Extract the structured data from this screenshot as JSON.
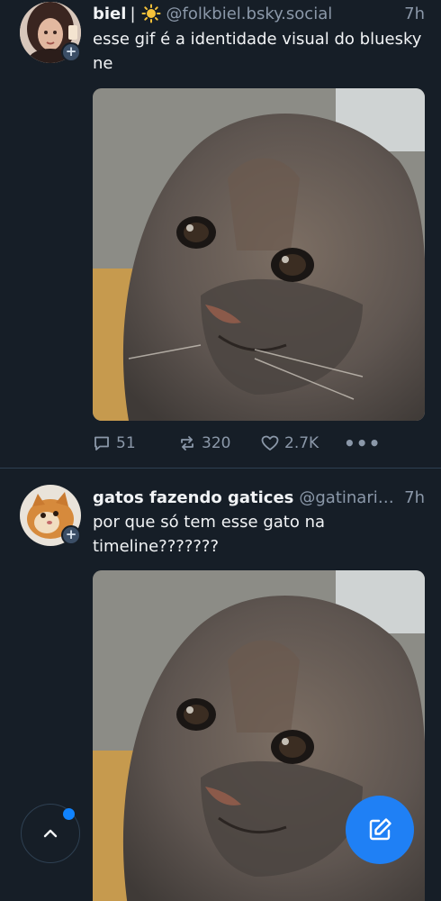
{
  "posts": [
    {
      "display_name": "biel",
      "separator": "|",
      "emoji_icon": "sun-icon",
      "handle": "@folkbiel.bsky.social",
      "time": "7h",
      "text": "esse gif é a identidade visual do bluesky ne",
      "reply_count": "51",
      "repost_count": "320",
      "like_count": "2.7K"
    },
    {
      "display_name": "gatos fazendo gatices",
      "handle": "@gatinarios.b...",
      "time": "7h",
      "text": "por que só tem esse gato na timeline???????"
    }
  ],
  "icons": {
    "reply": "reply-icon",
    "repost": "repost-icon",
    "like": "heart-icon",
    "more": "more-icon",
    "scroll_top": "chevron-up-icon",
    "compose": "compose-icon"
  },
  "more_glyph": "•••",
  "follow_glyph": "+",
  "colors": {
    "background": "#161e27",
    "secondary_text": "#8b98a9",
    "accent": "#1f80f5",
    "divider": "#2e4052"
  }
}
